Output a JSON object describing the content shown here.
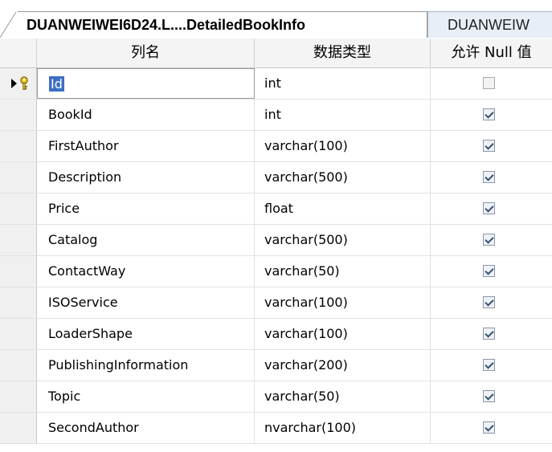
{
  "tabs": [
    {
      "label": "DUANWEIWEI6D24.L....DetailedBookInfo",
      "active": true
    },
    {
      "label": "DUANWEIW",
      "active": false
    }
  ],
  "columns": {
    "selector": "",
    "name": "列名",
    "type": "数据类型",
    "nullable": "允许 Null 值"
  },
  "rows": [
    {
      "name": "Id",
      "type": "int",
      "nullable": false,
      "primary_key": true,
      "current": true
    },
    {
      "name": "BookId",
      "type": "int",
      "nullable": true
    },
    {
      "name": "FirstAuthor",
      "type": "varchar(100)",
      "nullable": true
    },
    {
      "name": "Description",
      "type": "varchar(500)",
      "nullable": true
    },
    {
      "name": "Price",
      "type": "float",
      "nullable": true
    },
    {
      "name": "Catalog",
      "type": "varchar(500)",
      "nullable": true
    },
    {
      "name": "ContactWay",
      "type": "varchar(50)",
      "nullable": true
    },
    {
      "name": "ISOService",
      "type": "varchar(100)",
      "nullable": true
    },
    {
      "name": "LoaderShape",
      "type": "varchar(100)",
      "nullable": true
    },
    {
      "name": "PublishingInformation",
      "type": "varchar(200)",
      "nullable": true
    },
    {
      "name": "Topic",
      "type": "varchar(50)",
      "nullable": true
    },
    {
      "name": "SecondAuthor",
      "type": "nvarchar(100)",
      "nullable": true
    }
  ],
  "icons": {
    "current_row": "row-indicator-icon",
    "primary_key": "primary-key-icon",
    "check": "checkbox-check-icon"
  },
  "colors": {
    "selection": "#3d6fc4",
    "key_yellow": "#e8c21a",
    "checkbox_border": "#8a95a8"
  }
}
